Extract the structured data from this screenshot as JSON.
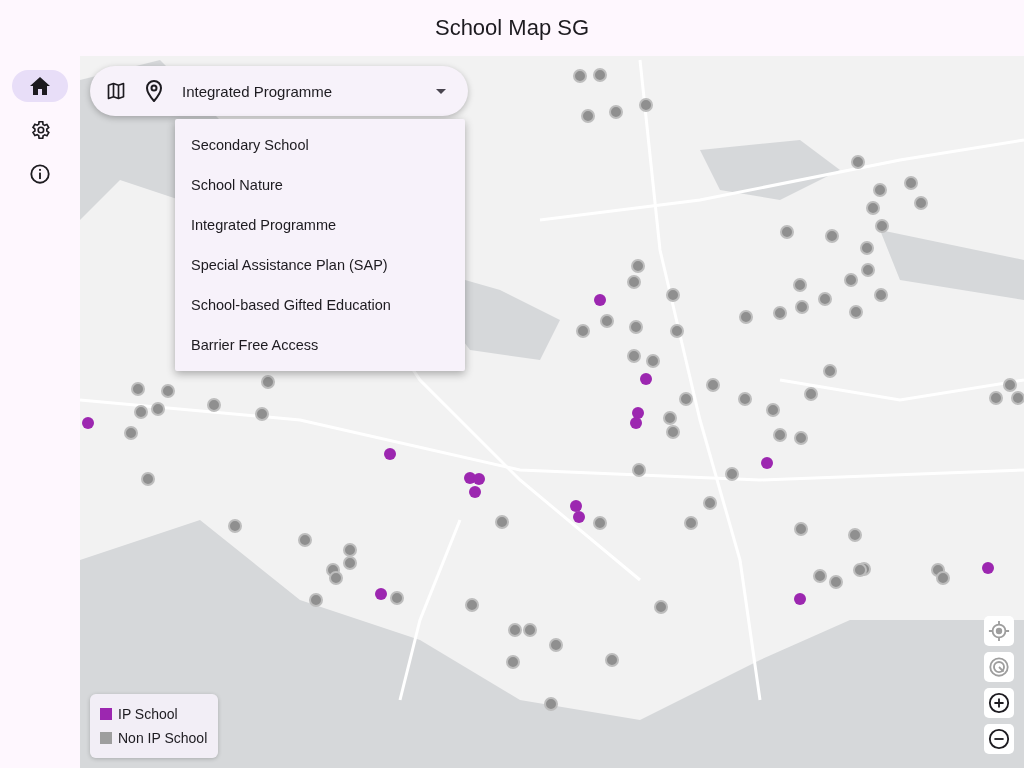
{
  "app_bar": {
    "title": "School Map SG"
  },
  "nav_rail": {
    "items": [
      {
        "kind": "home",
        "selected": true
      },
      {
        "kind": "settings",
        "selected": false
      },
      {
        "kind": "info",
        "selected": false
      }
    ]
  },
  "search_bar": {
    "value": "Integrated Programme"
  },
  "dropdown_menu": {
    "items": [
      "Secondary School",
      "School Nature",
      "Integrated Programme",
      "Special Assistance Plan (SAP)",
      "School-based Gifted Education",
      "Barrier Free Access"
    ]
  },
  "legend": {
    "items": [
      {
        "label": "IP School",
        "color": "#9c27b0"
      },
      {
        "label": "Non IP School",
        "color": "#9e9e9e"
      }
    ]
  },
  "map_controls": [
    {
      "kind": "locate",
      "disabled": true
    },
    {
      "kind": "compass",
      "disabled": true
    },
    {
      "kind": "zoom_in",
      "disabled": false
    },
    {
      "kind": "zoom_out",
      "disabled": false
    }
  ]
}
